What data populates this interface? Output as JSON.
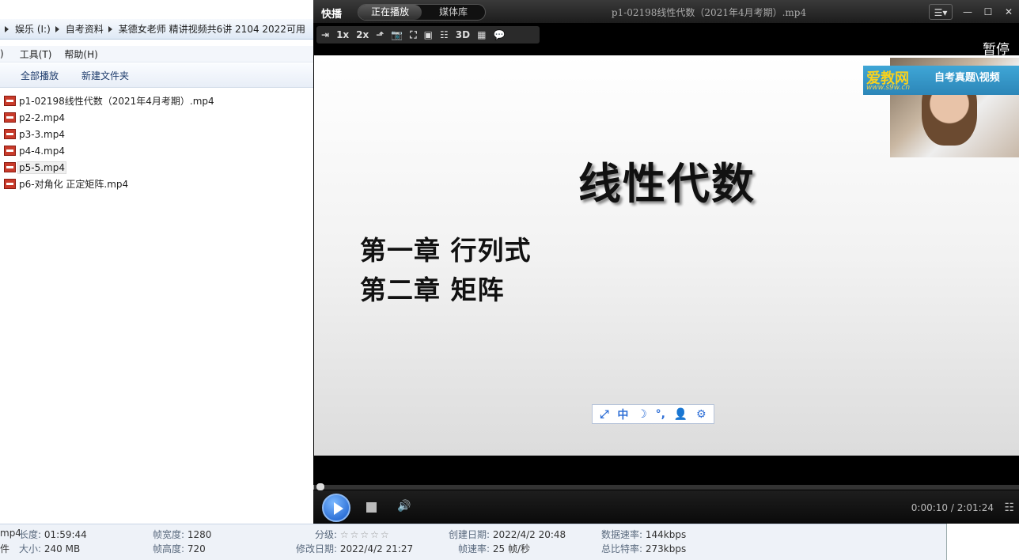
{
  "explorer": {
    "breadcrumbs": [
      "娱乐 (I:)",
      "自考资料",
      "某德女老师 精讲视频共6讲 2104 2022可用"
    ],
    "menu": [
      ")",
      "工具(T)",
      "帮助(H)"
    ],
    "toolbar": {
      "play_all": "全部播放",
      "new_folder": "新建文件夹"
    },
    "files": [
      "p1-02198线性代数（2021年4月考期）.mp4",
      "p2-2.mp4",
      "p3-3.mp4",
      "p4-4.mp4",
      "p5-5.mp4",
      "p6-对角化 正定矩阵.mp4"
    ]
  },
  "player": {
    "app_name": "快播",
    "tabs": [
      "正在播放",
      "媒体库"
    ],
    "title": "p1-02198线性代数（2021年4月考期）.mp4",
    "tools": [
      "⇥",
      "1x",
      "2x",
      "⬏",
      "📷",
      "⛶",
      "▣",
      "☷",
      "3D",
      "▦",
      "💬"
    ],
    "status": "暂停",
    "slide": {
      "title": "线性代数",
      "chapter1": "第一章 行列式",
      "chapter2": "第二章 矩阵"
    },
    "banner": {
      "brand": "爱教网",
      "subtitle": "自考真题\\视频",
      "url": "www.s9w.cn"
    },
    "ime": [
      "⤢",
      "中",
      "☽",
      "°,",
      "👤",
      "⚙"
    ],
    "progress": 0.0014,
    "time": "0:00:10 / 2:01:24"
  },
  "details": {
    "filename_tail": "mp4",
    "type_tail": "件",
    "length": {
      "k": "长度:",
      "v": "01:59:44"
    },
    "size": {
      "k": "大小:",
      "v": "240 MB"
    },
    "frame_width": {
      "k": "帧宽度:",
      "v": "1280"
    },
    "frame_height": {
      "k": "帧高度:",
      "v": "720"
    },
    "rating": {
      "k": "分级:",
      "v": "☆☆☆☆☆"
    },
    "modified": {
      "k": "修改日期:",
      "v": "2022/4/2 21:27"
    },
    "created": {
      "k": "创建日期:",
      "v": "2022/4/2 20:48"
    },
    "frame_rate": {
      "k": "帧速率:",
      "v": "25 帧/秒"
    },
    "data_rate": {
      "k": "数据速率:",
      "v": "144kbps"
    },
    "total_bitrate": {
      "k": "总比特率:",
      "v": "273kbps"
    }
  }
}
